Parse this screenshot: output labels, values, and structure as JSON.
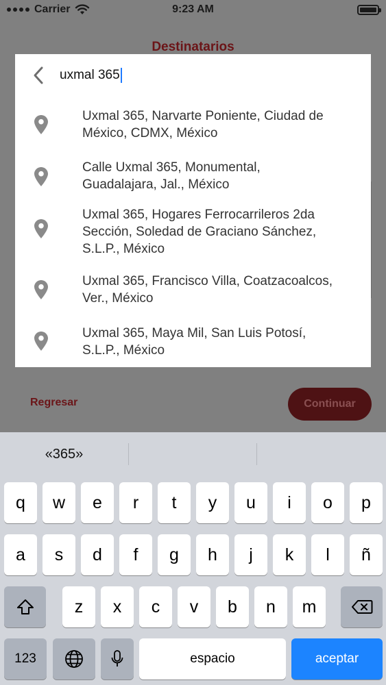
{
  "status_bar": {
    "carrier": "Carrier",
    "time": "9:23 AM"
  },
  "background": {
    "title": "Destinatarios",
    "back_label": "Regresar",
    "continue_label": "Continuar"
  },
  "search": {
    "query": "uxmal 365"
  },
  "results": [
    {
      "line1": "Uxmal 365, Narvarte Poniente, Ciudad de",
      "line2": "México, CDMX, México",
      "line3": ""
    },
    {
      "line1": "Calle Uxmal 365, Monumental,",
      "line2": "Guadalajara, Jal., México",
      "line3": ""
    },
    {
      "line1": "Uxmal 365, Hogares Ferrocarrileros 2da",
      "line2": "Sección, Soledad de Graciano Sánchez,",
      "line3": "S.L.P., México"
    },
    {
      "line1": "Uxmal 365, Francisco Villa, Coatzacoalcos,",
      "line2": "Ver., México",
      "line3": ""
    },
    {
      "line1": "Uxmal 365, Maya Mil, San Luis Potosí,",
      "line2": "S.L.P., México",
      "line3": ""
    }
  ],
  "keyboard": {
    "suggestions": [
      "«365»",
      "",
      ""
    ],
    "row1": [
      "q",
      "w",
      "e",
      "r",
      "t",
      "y",
      "u",
      "i",
      "o",
      "p"
    ],
    "row2": [
      "a",
      "s",
      "d",
      "f",
      "g",
      "h",
      "j",
      "k",
      "l",
      "ñ"
    ],
    "row3": [
      "z",
      "x",
      "c",
      "v",
      "b",
      "n",
      "m"
    ],
    "numbers_label": "123",
    "space_label": "espacio",
    "return_label": "aceptar",
    "icons": {
      "shift": "shift-icon",
      "delete": "backspace-icon",
      "globe": "globe-icon",
      "mic": "microphone-icon"
    }
  },
  "colors": {
    "accent_dark_red": "#6b1518",
    "keyboard_bg": "#d2d5db",
    "return_key": "#1c84ff",
    "overlay": "#808080"
  }
}
